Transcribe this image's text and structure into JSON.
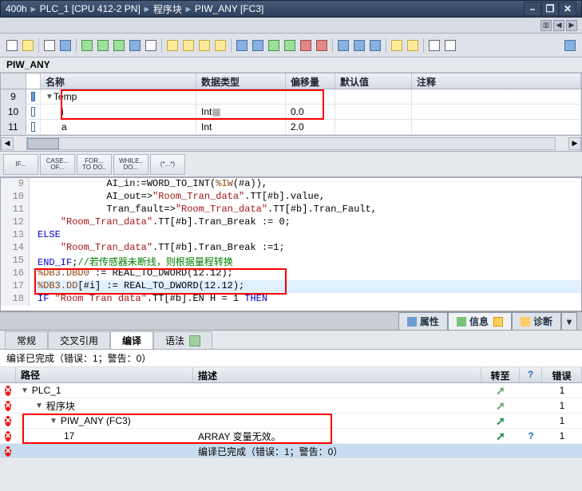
{
  "breadcrumb": {
    "p0": "400h",
    "p1": "PLC_1  [CPU  412-2 PN]",
    "p2": "程序块",
    "p3": "PIW_ANY [FC3]"
  },
  "paneName": "PIW_ANY",
  "varTable": {
    "headers": {
      "name": "名称",
      "type": "数据类型",
      "offset": "偏移量",
      "def": "默认值",
      "comment": "注释"
    },
    "rows": [
      {
        "rn": "9",
        "name": "Temp",
        "type": "",
        "offset": "",
        "def": "",
        "indent": 0,
        "arrow": true
      },
      {
        "rn": "10",
        "name": "i",
        "type": "Int",
        "offset": "0.0",
        "def": "",
        "indent": 1
      },
      {
        "rn": "11",
        "name": "a",
        "type": "Int",
        "offset": "2.0",
        "def": "",
        "indent": 1
      }
    ]
  },
  "kw": {
    "if": "IF...",
    "case1": "CASE...",
    "case2": "OF...",
    "for1": "FOR...",
    "for2": "TO DO..",
    "while1": "WHILE..",
    "while2": "DO...",
    "star": "(*...*)"
  },
  "code": [
    {
      "ln": "9",
      "html": "            AI_in:=WORD_TO_INT(<span class='kw-lit'>%IW</span>(#a)),"
    },
    {
      "ln": "10",
      "html": "            AI_out=><span class='kw-str'>\"Room_Tran_data\"</span>.TT[#b].value,"
    },
    {
      "ln": "11",
      "html": "            Tran_fault=><span class='kw-str'>\"Room_Tran_data\"</span>.TT[#b].Tran_Fault,"
    },
    {
      "ln": "12",
      "html": "    <span class='kw-str'>\"Room_Tran_data\"</span>.TT[#b].Tran_Break := 0;"
    },
    {
      "ln": "13",
      "html": "<span class='kw-blue'>ELSE</span>"
    },
    {
      "ln": "14",
      "html": "    <span class='kw-str'>\"Room_Tran_data\"</span>.TT[#b].Tran_Break :=1;"
    },
    {
      "ln": "15",
      "html": "<span class='kw-blue'>END_IF</span>;<span class='kw-grn'>//若传感器未断线，则根据量程转换</span>"
    },
    {
      "ln": "16",
      "html": "<span class='kw-lit'>%DB3.DBD0</span> := REAL_TO_DWORD(12.12);"
    },
    {
      "ln": "17",
      "html": "<span class='kw-lit'>%DB3.DD</span>[#i] := REAL_TO_DWORD(12.12);",
      "sel": true
    },
    {
      "ln": "18",
      "html": "<span class='kw-blue'>IF</span> <span class='kw-str'>\"Room Tran data\"</span>.TT[#b].EN H = 1 <span class='kw-blue'>THEN</span>"
    }
  ],
  "propTabs": {
    "prop": "属性",
    "info": "信息",
    "diag": "诊断"
  },
  "subTabs": {
    "general": "常规",
    "xref": "交叉引用",
    "compile": "编译",
    "syntax": "语法"
  },
  "compileStatus": "编译已完成（错误：1；警告：0）",
  "resHead": {
    "path": "路径",
    "desc": "描述",
    "go": "转至",
    "q": "?",
    "err": "错误"
  },
  "results": [
    {
      "path": "PLC_1",
      "desc": "",
      "indent": 0,
      "arrow": true,
      "err": "1",
      "go": "g"
    },
    {
      "path": "程序块",
      "desc": "",
      "indent": 1,
      "arrow": true,
      "err": "1",
      "go": "g"
    },
    {
      "path": "PIW_ANY (FC3)",
      "desc": "",
      "indent": 2,
      "arrow": true,
      "err": "1",
      "go": "a"
    },
    {
      "path": "17",
      "desc": "ARRAY 变量无效。",
      "indent": 3,
      "err": "1",
      "go": "a",
      "q": "?"
    },
    {
      "path": "",
      "desc": "编译已完成（错误：1；警告：0）",
      "indent": 3,
      "err": "",
      "sel": true
    }
  ]
}
